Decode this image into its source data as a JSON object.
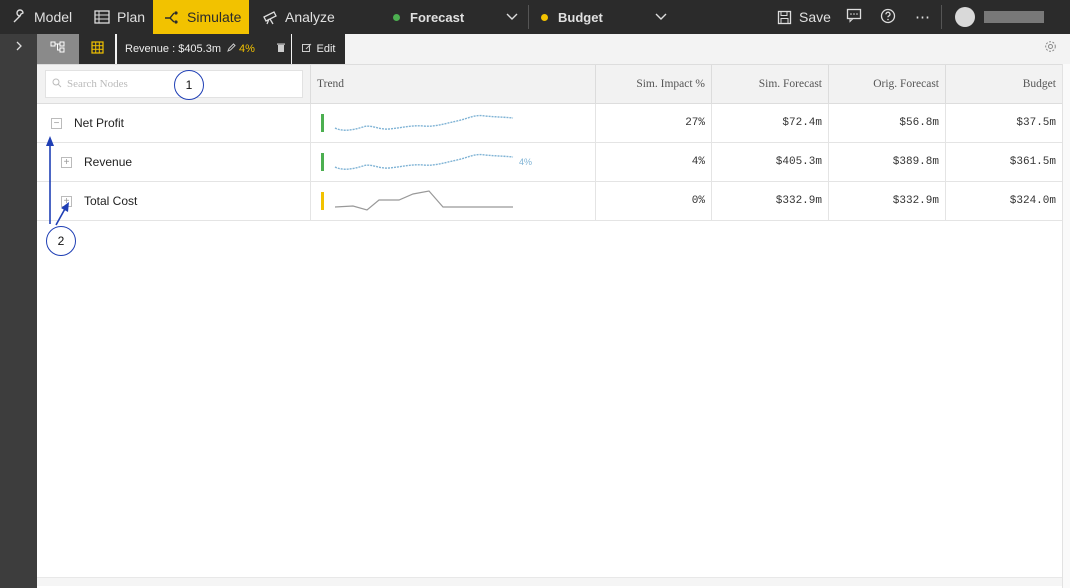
{
  "topbar": {
    "tabs": [
      {
        "label": "Model",
        "icon": "wrench-icon"
      },
      {
        "label": "Plan",
        "icon": "table-icon"
      },
      {
        "label": "Simulate",
        "icon": "simulate-icon",
        "active": true
      },
      {
        "label": "Analyze",
        "icon": "telescope-icon"
      }
    ],
    "scenarios": [
      {
        "label": "Forecast",
        "color": "#4caf50"
      },
      {
        "label": "Budget",
        "color": "#f2c200"
      }
    ],
    "save_label": "Save"
  },
  "toolbar": {
    "sim_label": "Revenue : $405.3m",
    "sim_change": "4%",
    "edit_label": "Edit"
  },
  "grid": {
    "search_placeholder": "Search Nodes",
    "columns": [
      "Trend",
      "Sim. Impact %",
      "Sim. Forecast",
      "Orig. Forecast",
      "Budget"
    ],
    "rows": [
      {
        "name": "Net Profit",
        "toggle": "−",
        "trend_color": "#4caf50",
        "trend_label": "",
        "impact": "27%",
        "sim_forecast": "$72.4m",
        "orig_forecast": "$56.8m",
        "budget": "$37.5m"
      },
      {
        "name": "Revenue",
        "toggle": "+",
        "trend_color": "#4caf50",
        "trend_label": "4%",
        "impact": "4%",
        "sim_forecast": "$405.3m",
        "orig_forecast": "$389.8m",
        "budget": "$361.5m"
      },
      {
        "name": "Total Cost",
        "toggle": "+",
        "trend_color": "#f2c200",
        "trend_label": "",
        "impact": "0%",
        "sim_forecast": "$332.9m",
        "orig_forecast": "$332.9m",
        "budget": "$324.0m"
      }
    ]
  },
  "annotations": [
    "1",
    "2"
  ],
  "colors": {
    "accent": "#f2c200",
    "topbar": "#2b2b2b",
    "annotation": "#1f3fb5",
    "trend_line": "#7fb3d5"
  }
}
